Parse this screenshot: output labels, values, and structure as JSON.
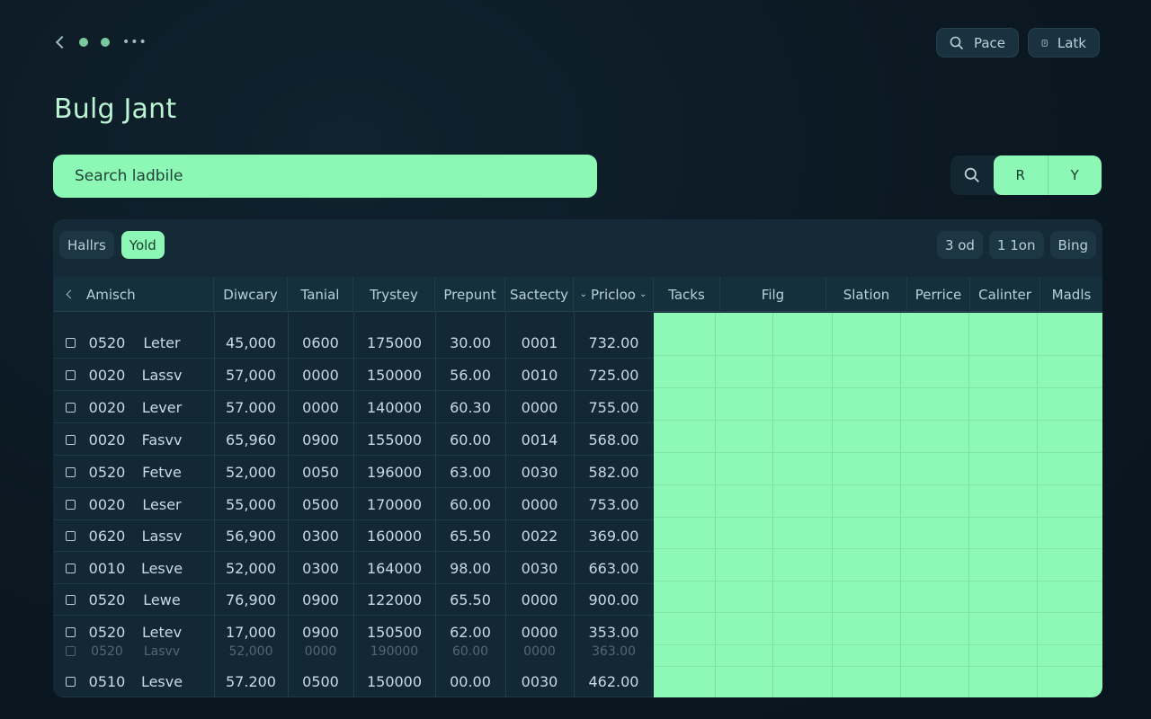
{
  "app": {
    "title": "Bulg Jant"
  },
  "topbar": {
    "pace_label": "Pace",
    "latch_label": "Latk"
  },
  "search": {
    "placeholder": "Search ladbile",
    "value": ""
  },
  "toolbar": {
    "sort_label": "R",
    "filter_label": "Y"
  },
  "filters": {
    "left": [
      "Hallrs",
      "Yold"
    ],
    "active_left": "Yold",
    "right": [
      "3 od",
      "1 1on",
      "Bing"
    ]
  },
  "table": {
    "columns": [
      "Amisch",
      "Diwcary",
      "Tanial",
      "Trystey",
      "Prepunt",
      "Sactecty",
      "Pricloo",
      "Tacks",
      "Filg",
      "Slation",
      "Perrice",
      "Calinter",
      "Madls"
    ],
    "rows": [
      [
        "0520",
        "Leter",
        "45,000",
        "0600",
        "175000",
        "30.00",
        "0001",
        "732.00"
      ],
      [
        "0020",
        "Lassv",
        "57,000",
        "0000",
        "150000",
        "56.00",
        "0010",
        "725.00"
      ],
      [
        "0020",
        "Lever",
        "57.000",
        "0000",
        "140000",
        "60.30",
        "0000",
        "755.00"
      ],
      [
        "0020",
        "Fasvv",
        "65,960",
        "0900",
        "155000",
        "60.00",
        "0014",
        "568.00"
      ],
      [
        "0520",
        "Fetve",
        "52,000",
        "0050",
        "196000",
        "63.00",
        "0030",
        "582.00"
      ],
      [
        "0020",
        "Leser",
        "55,000",
        "0500",
        "170000",
        "60.00",
        "0000",
        "753.00"
      ],
      [
        "0620",
        "Lassv",
        "56,900",
        "0300",
        "160000",
        "65.50",
        "0022",
        "369.00"
      ],
      [
        "0010",
        "Lesve",
        "52,000",
        "0300",
        "164000",
        "98.00",
        "0030",
        "663.00"
      ],
      [
        "0520",
        "Lewe",
        "76,900",
        "0900",
        "122000",
        "65.50",
        "0000",
        "900.00"
      ],
      [
        "0520",
        "Letev",
        "17,000",
        "0900",
        "150500",
        "62.00",
        "0000",
        "353.00"
      ],
      [
        "0520",
        "Lasvv",
        "52,000",
        "0000",
        "190000",
        "60.00",
        "0000",
        "363.00"
      ],
      [
        "0510",
        "Lesve",
        "57.200",
        "0500",
        "150000",
        "00.00",
        "0030",
        "462.00"
      ]
    ]
  },
  "colors": {
    "accent": "#8df7b6",
    "background": "#0b1822",
    "panel": "#142a36"
  }
}
